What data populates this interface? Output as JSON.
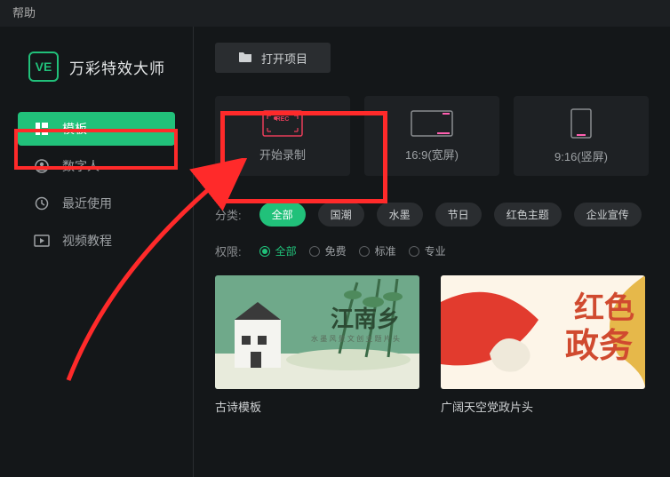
{
  "topbar": {
    "help": "帮助"
  },
  "brand": {
    "logo_text": "VE",
    "title": "万彩特效大师"
  },
  "sidebar": {
    "items": [
      {
        "label": "模板"
      },
      {
        "label": "数字人"
      },
      {
        "label": "最近使用"
      },
      {
        "label": "视频教程"
      }
    ]
  },
  "actions": {
    "open_project": "打开项目"
  },
  "cards": [
    {
      "label": "开始录制"
    },
    {
      "label": "16:9(宽屏)"
    },
    {
      "label": "9:16(竖屏)"
    }
  ],
  "filters": {
    "category_label": "分类:",
    "categories": [
      "全部",
      "国潮",
      "水墨",
      "节日",
      "红色主题",
      "企业宣传"
    ],
    "permission_label": "权限:",
    "permissions": [
      "全部",
      "免费",
      "标准",
      "专业"
    ]
  },
  "templates": [
    {
      "title": "古诗模板"
    },
    {
      "title": "广阔天空党政片头"
    }
  ]
}
